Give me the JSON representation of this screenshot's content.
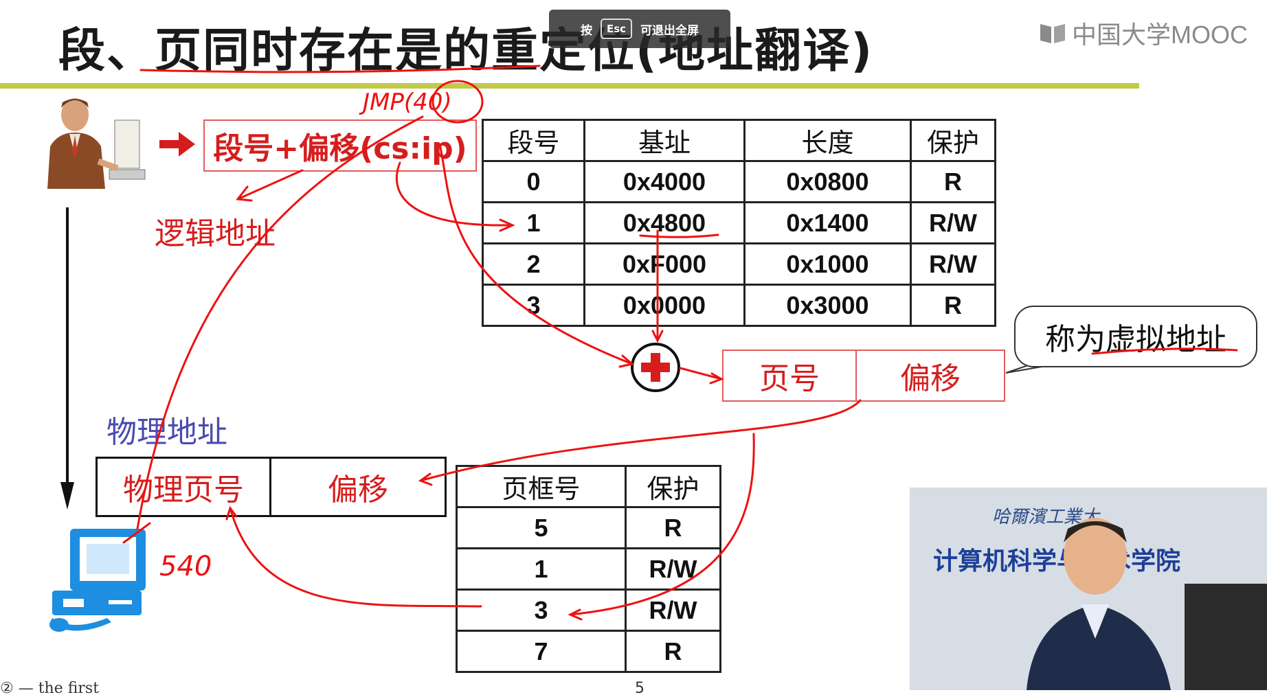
{
  "slide": {
    "title": "段、页同时存在是的重定位(地址翻译)",
    "brand": "中国大学MOOC",
    "esc_hint": {
      "prefix": "按",
      "key": "Esc",
      "suffix": "可退出全屏"
    },
    "footer_text": "② — the first",
    "slide_number": "5"
  },
  "diagram": {
    "logical_address_box": "段号+偏移(cs:ip)",
    "logical_address_label": "逻辑地址",
    "physical_address_label": "物理地址",
    "physical_box": {
      "page": "物理页号",
      "offset": "偏移"
    },
    "virtual_box": {
      "page": "页号",
      "offset": "偏移"
    },
    "virtual_callout": "称为虚拟地址",
    "annotations": {
      "jmp": "JMP(40)",
      "result": "540"
    }
  },
  "segment_table": {
    "headers": [
      "段号",
      "基址",
      "长度",
      "保护"
    ],
    "rows": [
      [
        "0",
        "0x4000",
        "0x0800",
        "R"
      ],
      [
        "1",
        "0x4800",
        "0x1400",
        "R/W"
      ],
      [
        "2",
        "0xF000",
        "0x1000",
        "R/W"
      ],
      [
        "3",
        "0x0000",
        "0x3000",
        "R"
      ]
    ]
  },
  "page_table": {
    "headers": [
      "页框号",
      "保护"
    ],
    "rows": [
      [
        "5",
        "R"
      ],
      [
        "1",
        "R/W"
      ],
      [
        "3",
        "R/W"
      ],
      [
        "7",
        "R"
      ]
    ]
  },
  "webcam": {
    "line1": "哈爾濱工業大",
    "line2": "计算机科学与技术学院"
  },
  "colors": {
    "accent_red": "#d61d1d",
    "title_rule": "#c3c94a",
    "label_blue": "#4a4ab0"
  }
}
